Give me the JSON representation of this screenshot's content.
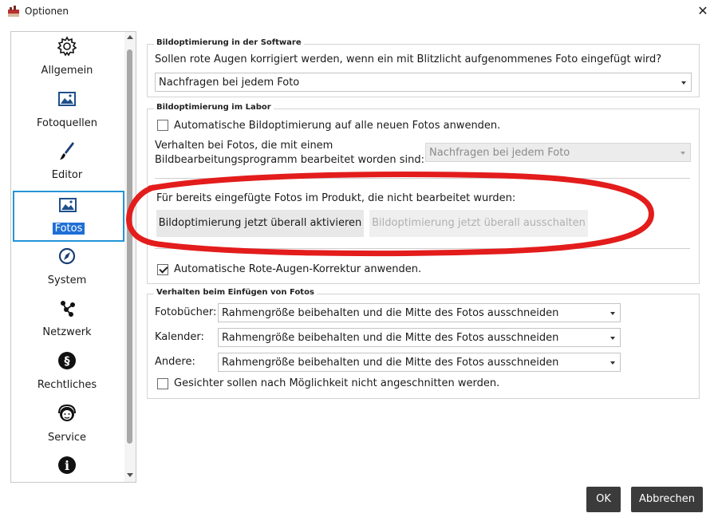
{
  "window": {
    "title": "Optionen",
    "close_glyph": "✕"
  },
  "sidebar": {
    "items": [
      {
        "label": "Allgemein",
        "icon": "gear-icon"
      },
      {
        "label": "Fotoquellen",
        "icon": "picture-icon"
      },
      {
        "label": "Editor",
        "icon": "brush-icon"
      },
      {
        "label": "Fotos",
        "icon": "picture-icon",
        "selected": true
      },
      {
        "label": "System",
        "icon": "compass-icon"
      },
      {
        "label": "Netzwerk",
        "icon": "network-icon"
      },
      {
        "label": "Rechtliches",
        "icon": "paragraph-icon"
      },
      {
        "label": "Service",
        "icon": "headset-icon"
      },
      {
        "label": "",
        "icon": "info-icon"
      }
    ],
    "section_glyph": "§",
    "info_glyph": "i"
  },
  "software_group": {
    "legend": "Bildoptimierung in der Software",
    "question": "Sollen rote Augen korrigiert werden, wenn ein mit Blitzlicht aufgenommenes Foto eingefügt wird?",
    "select_value": "Nachfragen bei jedem Foto"
  },
  "labor_group": {
    "legend": "Bildoptimierung im Labor",
    "auto_checkbox_label": "Automatische Bildoptimierung auf alle neuen Fotos anwenden.",
    "auto_checked": false,
    "behavior_label_line1": "Verhalten bei Fotos, die mit einem",
    "behavior_label_line2": "Bildbearbeitungsprogramm bearbeitet worden sind:",
    "behavior_select_value": "Nachfragen bei jedem Foto",
    "already_inserted_label": "Für bereits eingefügte Fotos im Produkt, die nicht bearbeitet wurden:",
    "activate_button": "Bildoptimierung jetzt überall aktivieren",
    "deactivate_button": "Bildoptimierung jetzt überall ausschalten",
    "redeye_checkbox_label": "Automatische Rote-Augen-Korrektur anwenden.",
    "redeye_checked": true
  },
  "insert_group": {
    "legend": "Verhalten beim Einfügen von Fotos",
    "rows": [
      {
        "label": "Fotobücher:",
        "value": "Rahmengröße beibehalten und die Mitte des Fotos ausschneiden"
      },
      {
        "label": "Kalender:",
        "value": "Rahmengröße beibehalten und die Mitte des Fotos ausschneiden"
      },
      {
        "label": "Andere:",
        "value": "Rahmengröße beibehalten und die Mitte des Fotos ausschneiden"
      }
    ],
    "faces_checkbox_label": "Gesichter sollen nach Möglichkeit nicht angeschnitten werden.",
    "faces_checked": false
  },
  "footer": {
    "ok_label": "OK",
    "cancel_label": "Abbrechen"
  },
  "colors": {
    "selection_border": "#2495d6",
    "selection_fill": "#1f6fd6",
    "annotation_red": "#e31c1c",
    "dark_button": "#3b3b3b"
  }
}
